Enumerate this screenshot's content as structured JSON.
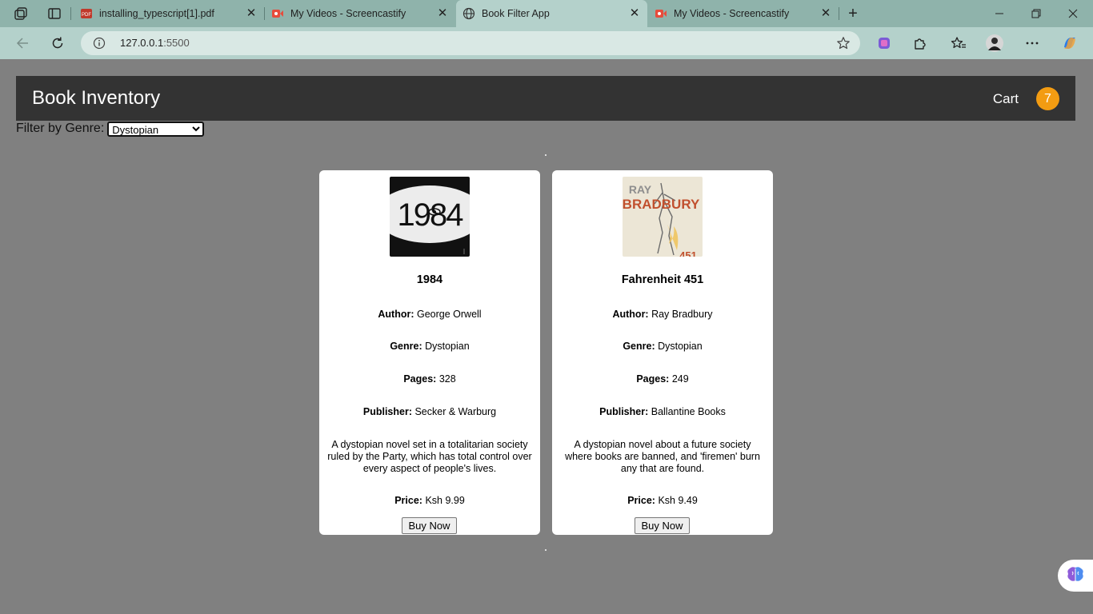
{
  "browser": {
    "tabs": [
      {
        "title": "installing_typescript[1].pdf",
        "icon": "pdf-icon"
      },
      {
        "title": "My Videos - Screencastify",
        "icon": "screencastify-icon"
      },
      {
        "title": "Book Filter App",
        "icon": "globe-icon",
        "active": true
      },
      {
        "title": "My Videos - Screencastify",
        "icon": "screencastify-icon"
      }
    ],
    "url_host": "127.0.0.1",
    "url_port": ":5500"
  },
  "header": {
    "title": "Book Inventory",
    "cart_label": "Cart",
    "cart_count": "7"
  },
  "filter": {
    "label": "Filter by Genre:",
    "selected": "Dystopian"
  },
  "books": [
    {
      "title": "1984",
      "cover_text": "1984",
      "author_label": "Author:",
      "author": "George Orwell",
      "genre_label": "Genre:",
      "genre": "Dystopian",
      "pages_label": "Pages:",
      "pages": "328",
      "publisher_label": "Publisher:",
      "publisher": "Secker & Warburg",
      "description": "A dystopian novel set in a totalitarian society ruled by the Party, which has total control over every aspect of people's lives.",
      "price_label": "Price:",
      "price": "Ksh 9.99",
      "buy_label": "Buy Now"
    },
    {
      "title": "Fahrenheit 451",
      "cover_text_top": "RAY",
      "cover_text_main": "BRADBURY",
      "cover_text_num": "451",
      "author_label": "Author:",
      "author": "Ray Bradbury",
      "genre_label": "Genre:",
      "genre": "Dystopian",
      "pages_label": "Pages:",
      "pages": "249",
      "publisher_label": "Publisher:",
      "publisher": "Ballantine Books",
      "description": "A dystopian novel about a future society where books are banned, and 'firemen' burn any that are found.",
      "price_label": "Price:",
      "price": "Ksh 9.49",
      "buy_label": "Buy Now"
    }
  ],
  "colors": {
    "page_bg": "#808080",
    "header_bg": "#333333",
    "badge": "#f39c12",
    "tab_strip": "#8fb3ab",
    "toolbar": "#b4d1cb"
  }
}
